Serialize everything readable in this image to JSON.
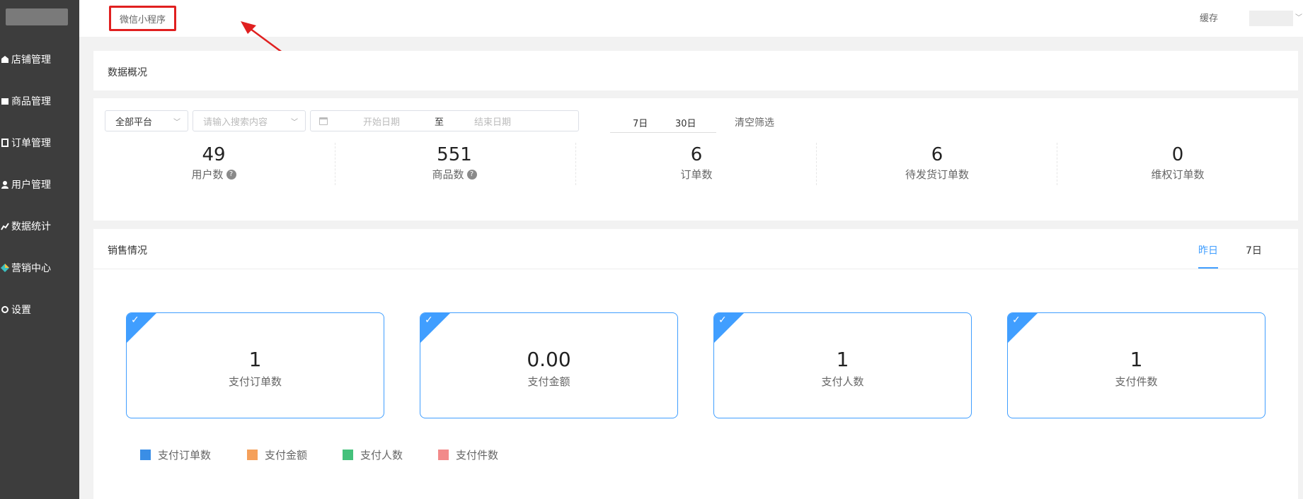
{
  "sidebar": {
    "items": [
      {
        "label": "店铺管理",
        "icon": "store-icon"
      },
      {
        "label": "商品管理",
        "icon": "goods-icon"
      },
      {
        "label": "订单管理",
        "icon": "order-icon"
      },
      {
        "label": "用户管理",
        "icon": "user-icon"
      },
      {
        "label": "数据统计",
        "icon": "chart-icon"
      },
      {
        "label": "营销中心",
        "icon": "marketing-icon"
      },
      {
        "label": "设置",
        "icon": "settings-icon"
      }
    ]
  },
  "topbar": {
    "tab_label": "微信小程序",
    "cache_label": "缓存"
  },
  "overview": {
    "title": "数据概况",
    "platform_select": "全部平台",
    "search_placeholder": "请输入搜索内容",
    "start_date_placeholder": "开始日期",
    "date_separator": "至",
    "end_date_placeholder": "结束日期",
    "quick_ranges": [
      "7日",
      "30日"
    ],
    "clear_label": "清空筛选",
    "stats": [
      {
        "value": "49",
        "label": "用户数",
        "help": true
      },
      {
        "value": "551",
        "label": "商品数",
        "help": true
      },
      {
        "value": "6",
        "label": "订单数",
        "help": false
      },
      {
        "value": "6",
        "label": "待发货订单数",
        "help": false
      },
      {
        "value": "0",
        "label": "维权订单数",
        "help": false
      }
    ]
  },
  "sales": {
    "title": "销售情况",
    "tabs": [
      "昨日",
      "7日"
    ],
    "active_tab": "昨日",
    "accent_color": "#409eff",
    "cards": [
      {
        "value": "1",
        "label": "支付订单数"
      },
      {
        "value": "0.00",
        "label": "支付金额"
      },
      {
        "value": "1",
        "label": "支付人数"
      },
      {
        "value": "1",
        "label": "支付件数"
      }
    ],
    "legend": [
      {
        "label": "支付订单数",
        "color": "#3a8ee6"
      },
      {
        "label": "支付金额",
        "color": "#f5a05a"
      },
      {
        "label": "支付人数",
        "color": "#44c17b"
      },
      {
        "label": "支付件数",
        "color": "#f28a8a"
      }
    ]
  }
}
